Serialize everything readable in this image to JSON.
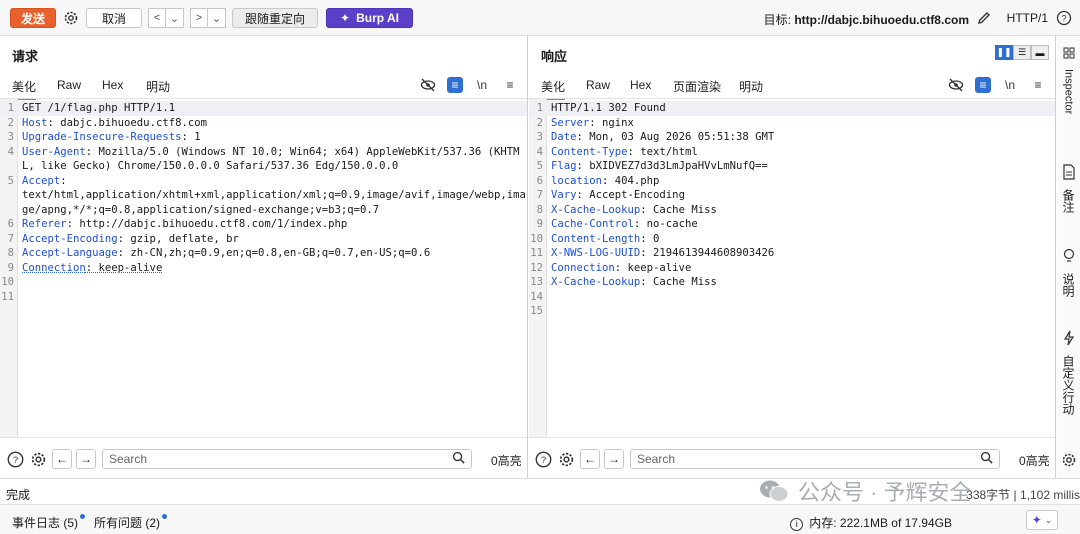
{
  "toolbar": {
    "send_label": "发送",
    "cancel_label": "取消",
    "redirect_label": "跟随重定向",
    "burp_ai_label": "Burp AI",
    "target_label": "目标:",
    "target_url": "http://dabjc.bihuoedu.ctf8.com",
    "http_version": "HTTP/1"
  },
  "request": {
    "title": "请求",
    "tabs": [
      "美化",
      "Raw",
      "Hex",
      "明动"
    ],
    "active_tab": "美化",
    "newline_toggle": "\\n",
    "lines": [
      {
        "n": "1",
        "key": "",
        "val": "GET /1/flag.php HTTP/1.1"
      },
      {
        "n": "2",
        "key": "Host",
        "val": ": dabjc.bihuoedu.ctf8.com"
      },
      {
        "n": "3",
        "key": "Upgrade-Insecure-Requests",
        "val": ": 1"
      },
      {
        "n": "4",
        "key": "User-Agent",
        "val": ": Mozilla/5.0 (Windows NT 10.0; Win64; x64) AppleWebKit/537.36 (KHTML, like Gecko) Chrome/150.0.0.0 Safari/537.36 Edg/150.0.0.0"
      },
      {
        "n": "5",
        "key": "Accept",
        "val": ":\ntext/html,application/xhtml+xml,application/xml;q=0.9,image/avif,image/webp,image/apng,*/*;q=0.8,application/signed-exchange;v=b3;q=0.7"
      },
      {
        "n": "6",
        "key": "Referer",
        "val": ": http://dabjc.bihuoedu.ctf8.com/1/index.php"
      },
      {
        "n": "7",
        "key": "Accept-Encoding",
        "val": ": gzip, deflate, br"
      },
      {
        "n": "8",
        "key": "Accept-Language",
        "val": ": zh-CN,zh;q=0.9,en;q=0.8,en-GB;q=0.7,en-US;q=0.6"
      },
      {
        "n": "9",
        "key": "Connection",
        "val": ": keep-alive"
      },
      {
        "n": "10",
        "key": "",
        "val": ""
      },
      {
        "n": "11",
        "key": "",
        "val": ""
      }
    ],
    "search_placeholder": "Search",
    "highlights": "0高亮"
  },
  "response": {
    "title": "响应",
    "tabs": [
      "美化",
      "Raw",
      "Hex",
      "页面渲染",
      "明动"
    ],
    "active_tab": "美化",
    "newline_toggle": "\\n",
    "lines": [
      {
        "n": "1",
        "key": "",
        "val": "HTTP/1.1 302 Found"
      },
      {
        "n": "2",
        "key": "Server",
        "val": ": nginx"
      },
      {
        "n": "3",
        "key": "Date",
        "val": ": Mon, 03 Aug 2026 05:51:38 GMT"
      },
      {
        "n": "4",
        "key": "Content-Type",
        "val": ": text/html"
      },
      {
        "n": "5",
        "key": "Flag",
        "val": ": bXIDVEZ7d3d3LmJpaHVvLmNufQ=="
      },
      {
        "n": "6",
        "key": "location",
        "val": ": 404.php"
      },
      {
        "n": "7",
        "key": "Vary",
        "val": ": Accept-Encoding"
      },
      {
        "n": "8",
        "key": "X-Cache-Lookup",
        "val": ": Cache Miss"
      },
      {
        "n": "9",
        "key": "Cache-Control",
        "val": ": no-cache"
      },
      {
        "n": "10",
        "key": "Content-Length",
        "val": ": 0"
      },
      {
        "n": "11",
        "key": "X-NWS-LOG-UUID",
        "val": ": 2194613944608903426"
      },
      {
        "n": "12",
        "key": "Connection",
        "val": ": keep-alive"
      },
      {
        "n": "13",
        "key": "X-Cache-Lookup",
        "val": ": Cache Miss"
      },
      {
        "n": "14",
        "key": "",
        "val": ""
      },
      {
        "n": "15",
        "key": "",
        "val": ""
      }
    ],
    "search_placeholder": "Search",
    "highlights": "0高亮"
  },
  "sidebar": {
    "inspector": "Inspector",
    "notes": "备注",
    "explain": "说明",
    "custom_actions": "自定义行动"
  },
  "status": {
    "done": "完成",
    "bytes": "338字节 | 1,102 millis"
  },
  "footer": {
    "event_log": "事件日志 (5)",
    "all_issues": "所有问题 (2)",
    "memory": "内存: 222.1MB of 17.94GB"
  },
  "watermark": {
    "text": "公众号 · 予辉安全"
  },
  "colors": {
    "accent_orange": "#e8602c",
    "burp_purple": "#5b3fc8",
    "header_key_blue": "#1e4fd8"
  }
}
